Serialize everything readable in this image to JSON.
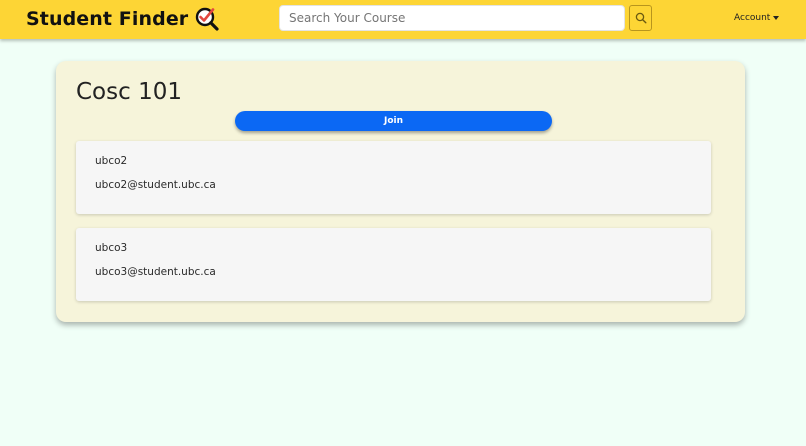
{
  "header": {
    "brand_name": "Student Finder",
    "search": {
      "placeholder": "Search Your Course",
      "value": ""
    },
    "account_label": "Account"
  },
  "course": {
    "title": "Cosc 101",
    "join_label": "Join",
    "students": [
      {
        "username": "ubco2",
        "email": "ubco2@student.ubc.ca"
      },
      {
        "username": "ubco3",
        "email": "ubco3@student.ubc.ca"
      }
    ]
  },
  "colors": {
    "header_bg": "#fdd535",
    "page_bg": "#f0fff7",
    "card_bg": "#f6f4da",
    "join_button": "#0b68f4",
    "logo_accent": "#e2473f"
  },
  "icons": {
    "logo": "magnifier-checkmark-icon",
    "search": "search-icon",
    "account_caret": "caret-down-icon"
  }
}
